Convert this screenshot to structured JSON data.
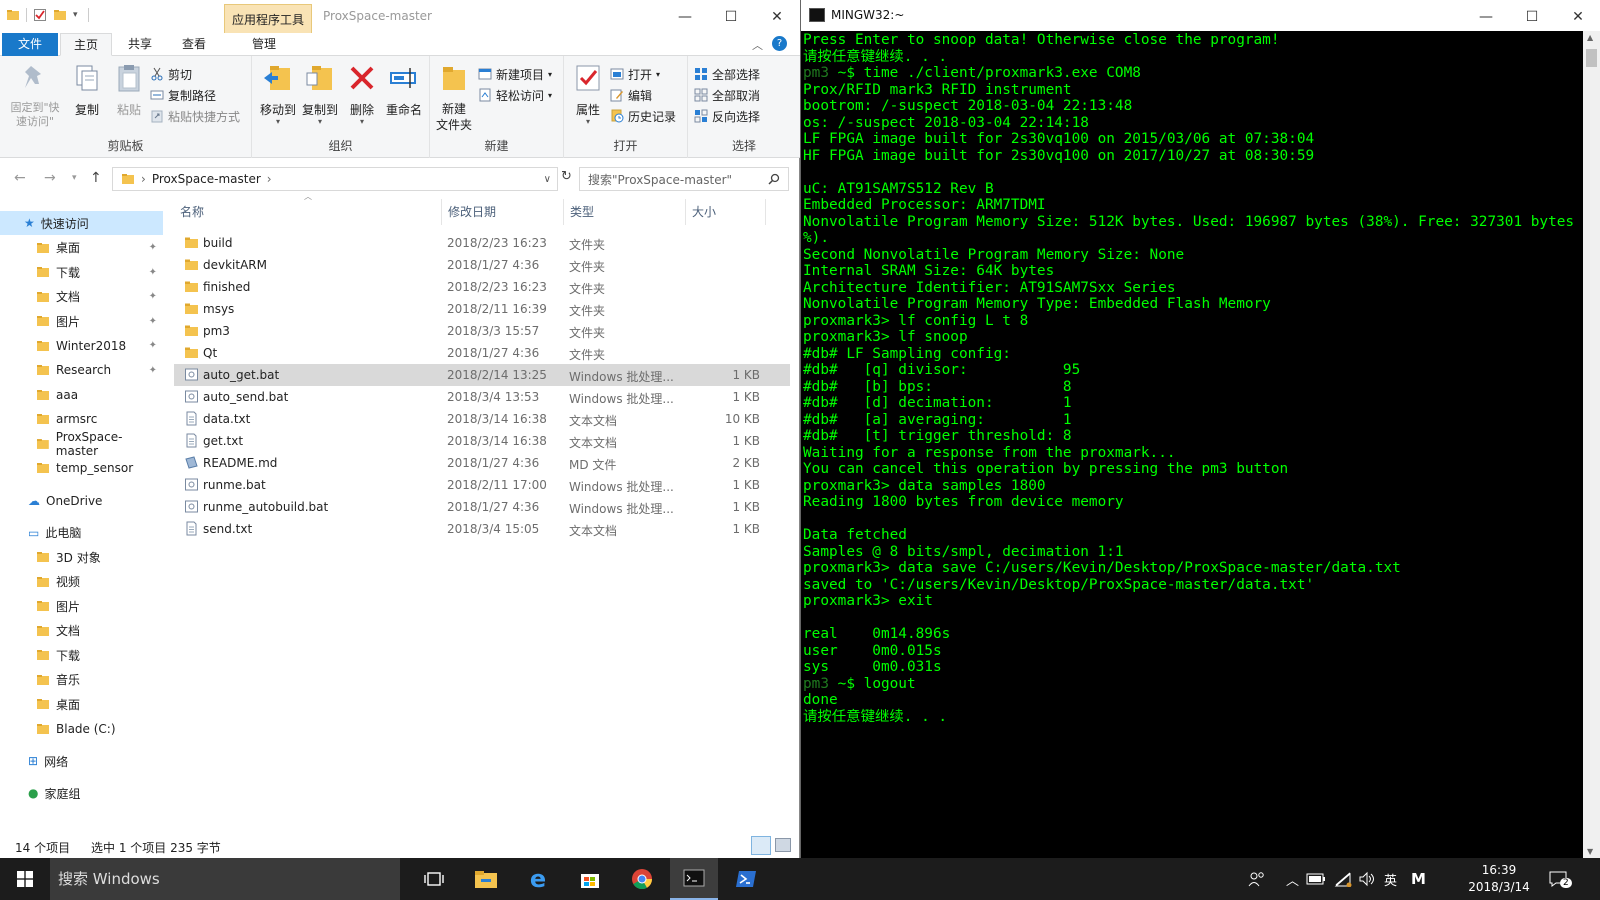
{
  "explorer": {
    "window_title": "ProxSpace-master",
    "context_tab": "应用程序工具",
    "tabs": {
      "file": "文件",
      "home": "主页",
      "share": "共享",
      "view": "查看",
      "manage": "管理"
    },
    "ribbon": {
      "clipboard": {
        "label": "剪贴板",
        "pin": "固定到\"快速访问\"",
        "copy": "复制",
        "paste": "粘贴",
        "cut": "剪切",
        "copy_path": "复制路径",
        "paste_shortcut": "粘贴快捷方式"
      },
      "organize": {
        "label": "组织",
        "move_to": "移动到",
        "copy_to": "复制到",
        "delete": "删除",
        "rename": "重命名"
      },
      "new": {
        "label": "新建",
        "new_folder": "新建\n文件夹",
        "new_item": "新建项目",
        "easy_access": "轻松访问"
      },
      "open": {
        "label": "打开",
        "properties": "属性",
        "open": "打开",
        "edit": "编辑",
        "history": "历史记录"
      },
      "select": {
        "label": "选择",
        "select_all": "全部选择",
        "select_none": "全部取消",
        "invert": "反向选择"
      }
    },
    "address": {
      "path": "ProxSpace-master",
      "search_placeholder": "搜索\"ProxSpace-master\""
    },
    "nav": {
      "quick_access": "快速访问",
      "quick_items": [
        {
          "label": "桌面",
          "pinned": true
        },
        {
          "label": "下载",
          "pinned": true
        },
        {
          "label": "文档",
          "pinned": true
        },
        {
          "label": "图片",
          "pinned": true
        },
        {
          "label": "Winter2018",
          "pinned": true
        },
        {
          "label": "Research",
          "pinned": true
        },
        {
          "label": "aaa",
          "pinned": false
        },
        {
          "label": "armsrc",
          "pinned": false
        },
        {
          "label": "ProxSpace-master",
          "pinned": false
        },
        {
          "label": "temp_sensor",
          "pinned": false
        }
      ],
      "onedrive": "OneDrive",
      "this_pc": "此电脑",
      "pc_items": [
        "3D 对象",
        "视频",
        "图片",
        "文档",
        "下载",
        "音乐",
        "桌面",
        "Blade (C:)"
      ],
      "network": "网络",
      "homegroup": "家庭组"
    },
    "columns": {
      "name": "名称",
      "modified": "修改日期",
      "type": "类型",
      "size": "大小"
    },
    "files": [
      {
        "name": "build",
        "modified": "2018/2/23 16:23",
        "type": "文件夹",
        "size": "",
        "kind": "folder"
      },
      {
        "name": "devkitARM",
        "modified": "2018/1/27 4:36",
        "type": "文件夹",
        "size": "",
        "kind": "folder"
      },
      {
        "name": "finished",
        "modified": "2018/2/23 16:23",
        "type": "文件夹",
        "size": "",
        "kind": "folder"
      },
      {
        "name": "msys",
        "modified": "2018/2/11 16:39",
        "type": "文件夹",
        "size": "",
        "kind": "folder"
      },
      {
        "name": "pm3",
        "modified": "2018/3/3 15:57",
        "type": "文件夹",
        "size": "",
        "kind": "folder"
      },
      {
        "name": "Qt",
        "modified": "2018/1/27 4:36",
        "type": "文件夹",
        "size": "",
        "kind": "folder"
      },
      {
        "name": "auto_get.bat",
        "modified": "2018/2/14 13:25",
        "type": "Windows 批处理...",
        "size": "1 KB",
        "kind": "bat",
        "selected": true
      },
      {
        "name": "auto_send.bat",
        "modified": "2018/3/4 13:53",
        "type": "Windows 批处理...",
        "size": "1 KB",
        "kind": "bat"
      },
      {
        "name": "data.txt",
        "modified": "2018/3/14 16:38",
        "type": "文本文档",
        "size": "10 KB",
        "kind": "txt"
      },
      {
        "name": "get.txt",
        "modified": "2018/3/14 16:38",
        "type": "文本文档",
        "size": "1 KB",
        "kind": "txt"
      },
      {
        "name": "README.md",
        "modified": "2018/1/27 4:36",
        "type": "MD 文件",
        "size": "2 KB",
        "kind": "md"
      },
      {
        "name": "runme.bat",
        "modified": "2018/2/11 17:00",
        "type": "Windows 批处理...",
        "size": "1 KB",
        "kind": "bat"
      },
      {
        "name": "runme_autobuild.bat",
        "modified": "2018/1/27 4:36",
        "type": "Windows 批处理...",
        "size": "1 KB",
        "kind": "bat"
      },
      {
        "name": "send.txt",
        "modified": "2018/3/4 15:05",
        "type": "文本文档",
        "size": "1 KB",
        "kind": "txt"
      }
    ],
    "status": {
      "count": "14 个项目",
      "selection": "选中 1 个项目 235 字节"
    }
  },
  "terminal": {
    "title": "MINGW32:~",
    "lines": [
      {
        "t": "Press Enter to snoop data! Otherwise close the program!"
      },
      {
        "t": "请按任意键继续. . ."
      },
      {
        "p": "pm3",
        "t": " ~$ time ./client/proxmark3.exe COM8"
      },
      {
        "t": "Prox/RFID mark3 RFID instrument"
      },
      {
        "t": "bootrom: /-suspect 2018-03-04 22:13:48"
      },
      {
        "t": "os: /-suspect 2018-03-04 22:14:18"
      },
      {
        "t": "LF FPGA image built for 2s30vq100 on 2015/03/06 at 07:38:04"
      },
      {
        "t": "HF FPGA image built for 2s30vq100 on 2017/10/27 at 08:30:59"
      },
      {
        "t": ""
      },
      {
        "t": "uC: AT91SAM7S512 Rev B"
      },
      {
        "t": "Embedded Processor: ARM7TDMI"
      },
      {
        "t": "Nonvolatile Program Memory Size: 512K bytes. Used: 196987 bytes (38%). Free: 327301 bytes (62"
      },
      {
        "t": "%)."
      },
      {
        "t": "Second Nonvolatile Program Memory Size: None"
      },
      {
        "t": "Internal SRAM Size: 64K bytes"
      },
      {
        "t": "Architecture Identifier: AT91SAM7Sxx Series"
      },
      {
        "t": "Nonvolatile Program Memory Type: Embedded Flash Memory"
      },
      {
        "t": "proxmark3> lf config L t 8"
      },
      {
        "t": "proxmark3> lf snoop"
      },
      {
        "t": "#db# LF Sampling config:"
      },
      {
        "t": "#db#   [q] divisor:           95"
      },
      {
        "t": "#db#   [b] bps:               8"
      },
      {
        "t": "#db#   [d] decimation:        1"
      },
      {
        "t": "#db#   [a] averaging:         1"
      },
      {
        "t": "#db#   [t] trigger threshold: 8"
      },
      {
        "t": "Waiting for a response from the proxmark..."
      },
      {
        "t": "You can cancel this operation by pressing the pm3 button"
      },
      {
        "t": "proxmark3> data samples 1800"
      },
      {
        "t": "Reading 1800 bytes from device memory"
      },
      {
        "t": ""
      },
      {
        "t": "Data fetched"
      },
      {
        "t": "Samples @ 8 bits/smpl, decimation 1:1"
      },
      {
        "t": "proxmark3> data save C:/users/Kevin/Desktop/ProxSpace-master/data.txt"
      },
      {
        "t": "saved to 'C:/users/Kevin/Desktop/ProxSpace-master/data.txt'"
      },
      {
        "t": "proxmark3> exit"
      },
      {
        "t": ""
      },
      {
        "t": "real    0m14.896s"
      },
      {
        "t": "user    0m0.015s"
      },
      {
        "t": "sys     0m0.031s"
      },
      {
        "p": "pm3",
        "t": " ~$ logout"
      },
      {
        "t": "done"
      },
      {
        "t": "请按任意键继续. . ."
      }
    ]
  },
  "taskbar": {
    "search_placeholder": "搜索 Windows",
    "ime": "英",
    "ime_mode": "M",
    "time": "16:39",
    "date": "2018/3/14",
    "notifications": "2"
  },
  "colors": {
    "terminal_text": "#00ff00",
    "explorer_accent": "#1979ca",
    "selection_nav": "#cce8ff",
    "folder": "#f4c34f"
  }
}
